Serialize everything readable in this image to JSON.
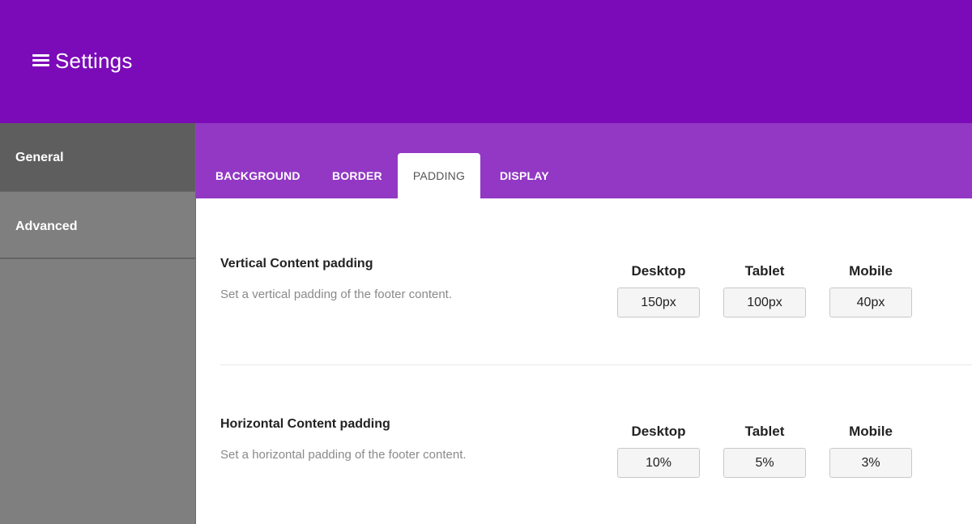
{
  "header": {
    "title": "Settings",
    "menu_icon": "hamburger-icon",
    "background": "#7b0ab8"
  },
  "sidebar": {
    "items": [
      {
        "label": "General",
        "active": true
      },
      {
        "label": "Advanced",
        "active": false
      }
    ]
  },
  "tabs": {
    "items": [
      {
        "label": "BACKGROUND",
        "active": false
      },
      {
        "label": "BORDER",
        "active": false
      },
      {
        "label": "PADDING",
        "active": true
      },
      {
        "label": "DISPLAY",
        "active": false
      }
    ],
    "background": "#9238c4"
  },
  "sections": [
    {
      "title": "Vertical Content padding",
      "description": "Set a vertical padding of the footer content.",
      "fields": [
        {
          "label": "Desktop",
          "value": "150px"
        },
        {
          "label": "Tablet",
          "value": "100px"
        },
        {
          "label": "Mobile",
          "value": "40px"
        }
      ]
    },
    {
      "title": "Horizontal Content padding",
      "description": "Set a horizontal padding of the footer content.",
      "fields": [
        {
          "label": "Desktop",
          "value": "10%"
        },
        {
          "label": "Tablet",
          "value": "5%"
        },
        {
          "label": "Mobile",
          "value": "3%"
        }
      ]
    }
  ]
}
